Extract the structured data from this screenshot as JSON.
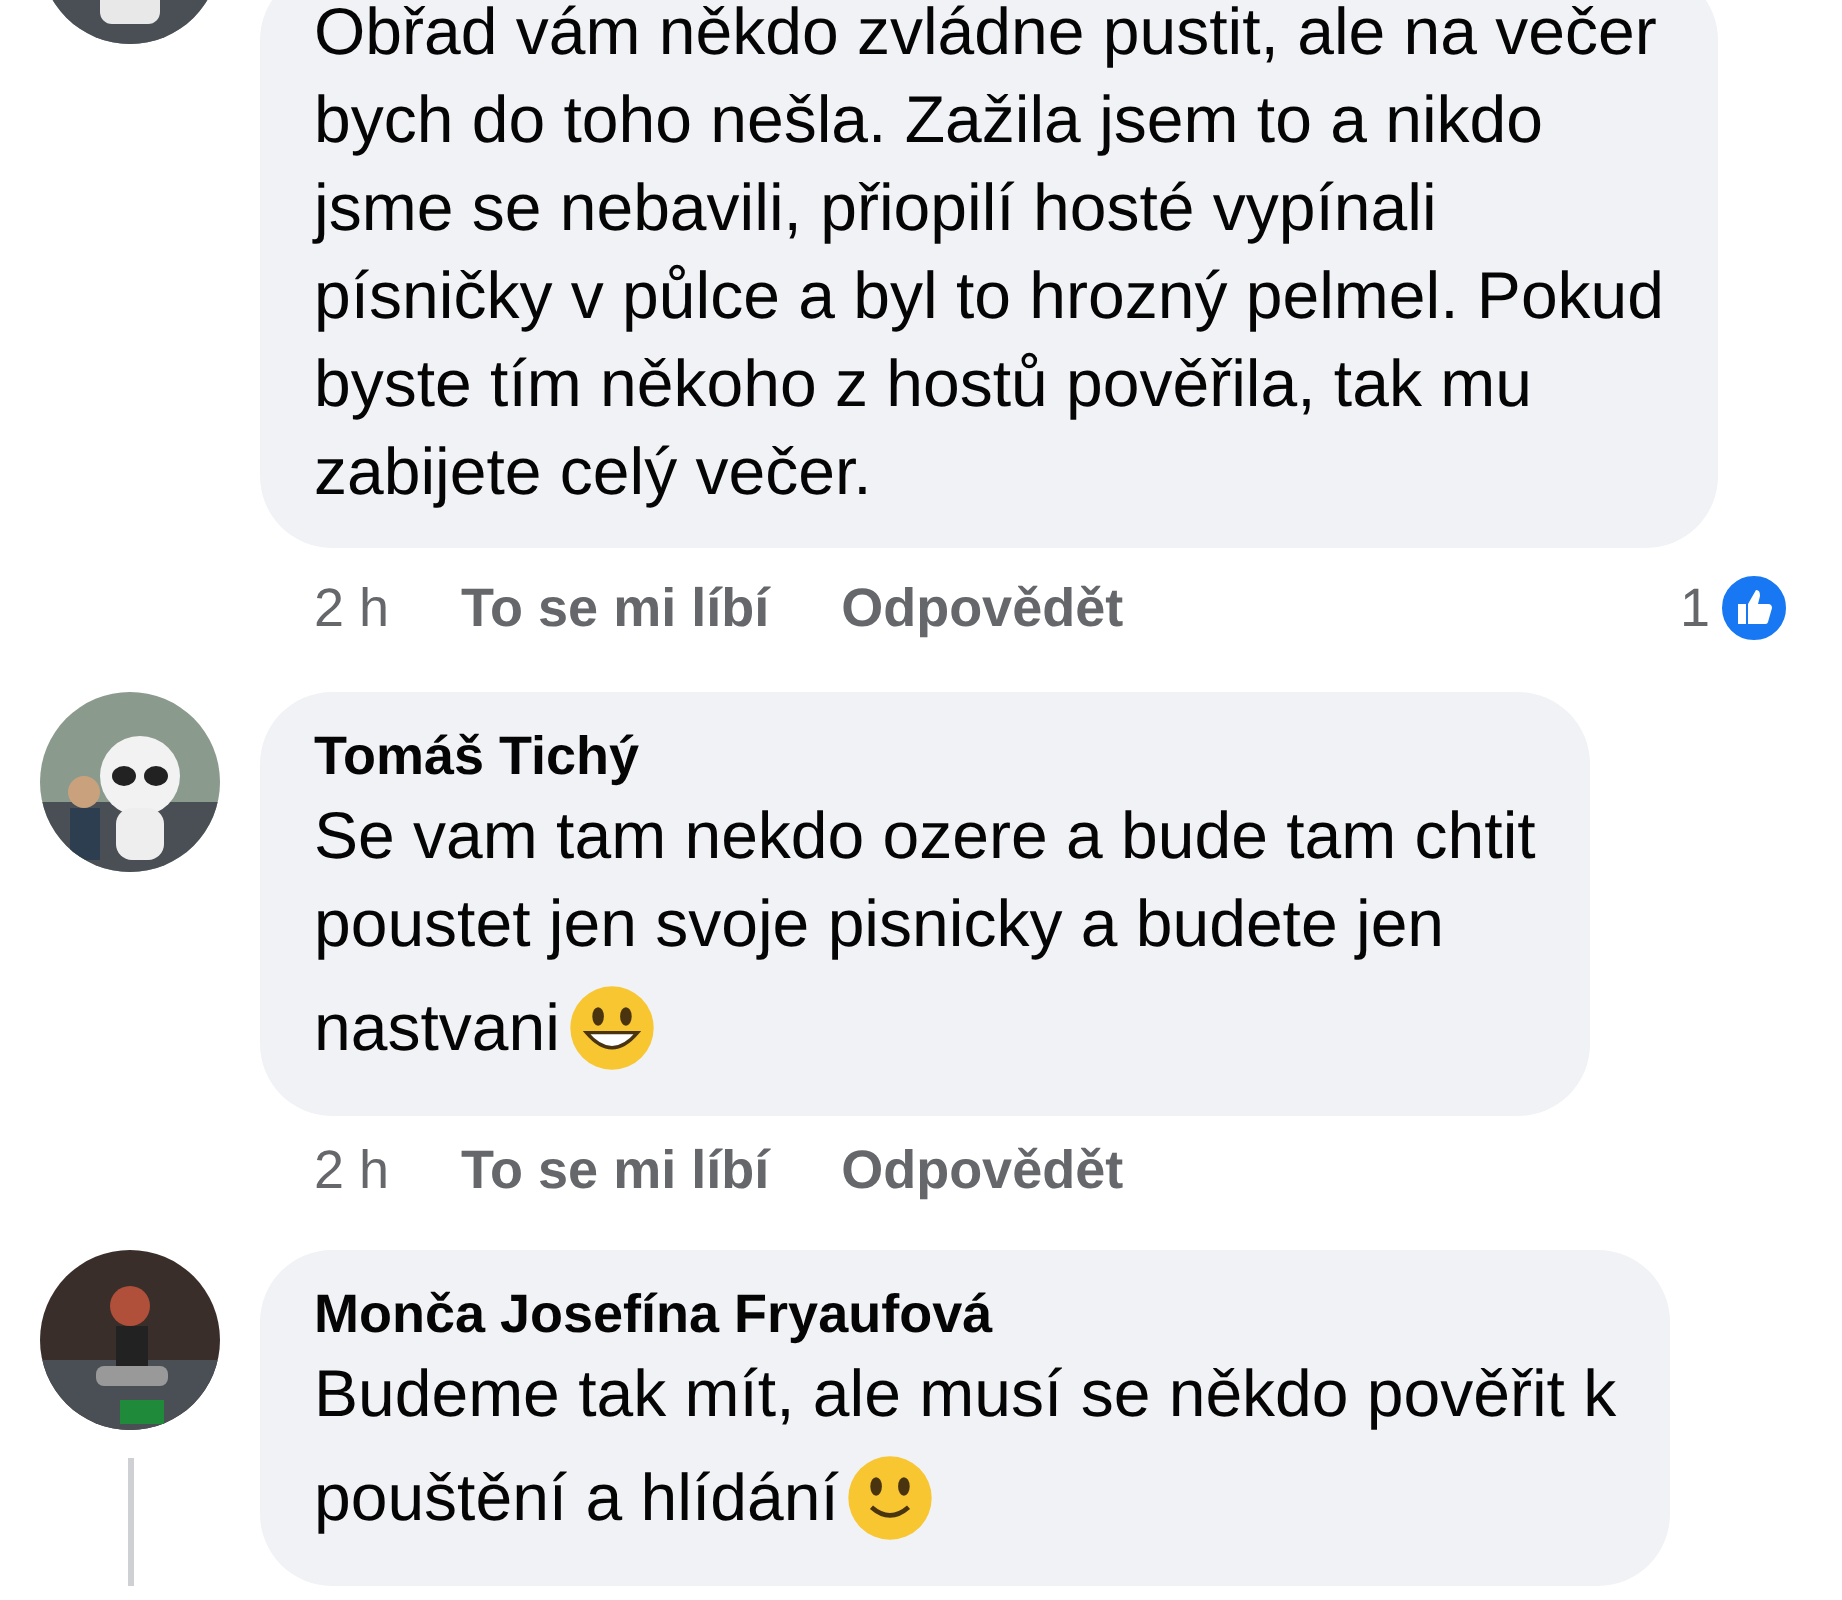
{
  "comments": [
    {
      "lines": [
        {
          "kind": "text",
          "text": "Obřad vám někdo zvládne pustit, ale na večer\nbych do toho nešla. Zažila jsem to a nikdo\njsme se nebavili, přiopilí hosté vypínali\npísničky v půlce a byl to hrozný pelmel. Pokud\nbyste tím někoho z hostů pověřila, tak mu\nzabijete celý večer."
        }
      ],
      "time": "2 h",
      "like": "To se mi líbí",
      "reply": "Odpovědět",
      "reaction_count": "1",
      "has_replies": false
    },
    {
      "author": "Tomáš Tichý",
      "lines": [
        {
          "kind": "text",
          "text": "Se vam tam nekdo ozere a bude tam chtit\npoustet jen svoje pisnicky a budete jen"
        },
        {
          "kind": "grin",
          "text": "nastvani"
        }
      ],
      "time": "2 h",
      "like": "To se mi líbí",
      "reply": "Odpovědět",
      "has_replies": false
    },
    {
      "author": "Monča Josefína Fryaufová",
      "lines": [
        {
          "kind": "text",
          "text": "Budeme tak mít, ale musí se někdo pověřit k"
        },
        {
          "kind": "smile",
          "text": "pouštění a hlídání"
        }
      ],
      "has_replies": true
    }
  ]
}
